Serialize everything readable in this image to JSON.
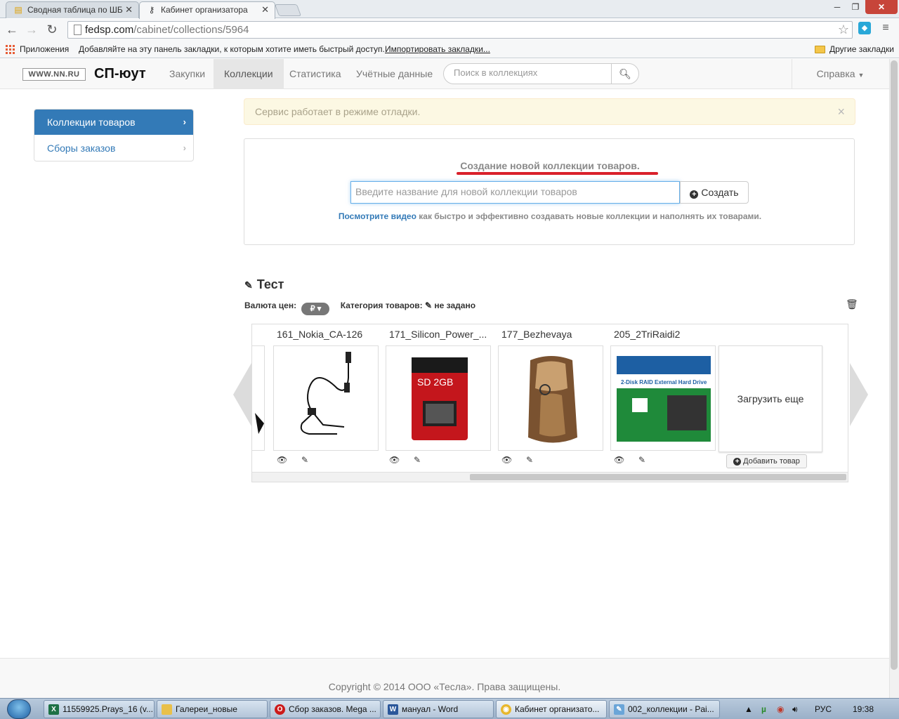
{
  "browser": {
    "tabs": [
      {
        "title": "Сводная таблица по ШБ"
      },
      {
        "title": "Кабинет организатора"
      }
    ],
    "url_host": "fedsp.com",
    "url_path": "/cabinet/collections/5964",
    "bookmarks": {
      "apps": "Приложения",
      "hint": "Добавляйте на эту панель закладки, к которым хотите иметь быстрый доступ.",
      "import": "Импортировать закладки...",
      "other": "Другие закладки"
    }
  },
  "site": {
    "logo_text": "WWW.NN.RU",
    "brand": "СП-юут",
    "nav": [
      "Закупки",
      "Коллекции",
      "Статистика",
      "Учётные данные"
    ],
    "search_placeholder": "Поиск в коллекциях",
    "help": "Справка"
  },
  "sidebar": {
    "items": [
      {
        "label": "Коллекции товаров",
        "active": true
      },
      {
        "label": "Сборы заказов",
        "active": false
      }
    ]
  },
  "alert": {
    "text": "Сервис работает в режиме отладки.",
    "close": "×"
  },
  "create": {
    "title": "Создание новой коллекции товаров.",
    "placeholder": "Введите название для новой коллекции товаров",
    "button": "Создать",
    "hint_link": "Посмотрите видео",
    "hint_text": " как быстро и эффективно создавать новые коллекции и наполнять их товарами."
  },
  "collection": {
    "title": "Тест",
    "currency_label": "Валюта цен:",
    "currency_value": "₽",
    "category_label": "Категория товаров:",
    "category_value": "не задано",
    "products": [
      {
        "name": "161_Nokia_CA-126"
      },
      {
        "name": "171_Silicon_Power_..."
      },
      {
        "name": "177_Bezhevaya"
      },
      {
        "name": "205_2TriRaidi2"
      }
    ],
    "load_more": "Загрузить еще",
    "add_product": "Добавить товар"
  },
  "footer": {
    "text": "Copyright © 2014 ООО «Тесла». Права защищены."
  },
  "taskbar": {
    "tasks": [
      {
        "label": "11559925.Prays_16 (v..."
      },
      {
        "label": "Галереи_новые"
      },
      {
        "label": "Сбор заказов. Mega ..."
      },
      {
        "label": "мануал - Word"
      },
      {
        "label": "Кабинет организато..."
      },
      {
        "label": "002_коллекции - Pai..."
      }
    ],
    "lang": "РУС",
    "time": "19:38"
  },
  "colors": {
    "primary": "#337ab7",
    "alert_bg": "#fcf8e3",
    "underline": "#d9202b",
    "window_close": "#c7453a"
  },
  "icons": [
    "back-icon",
    "forward-icon",
    "reload-icon",
    "star-icon",
    "search-icon",
    "chevron-right-icon",
    "pencil-icon",
    "eye-icon",
    "trash-icon",
    "plus-circle-icon"
  ]
}
